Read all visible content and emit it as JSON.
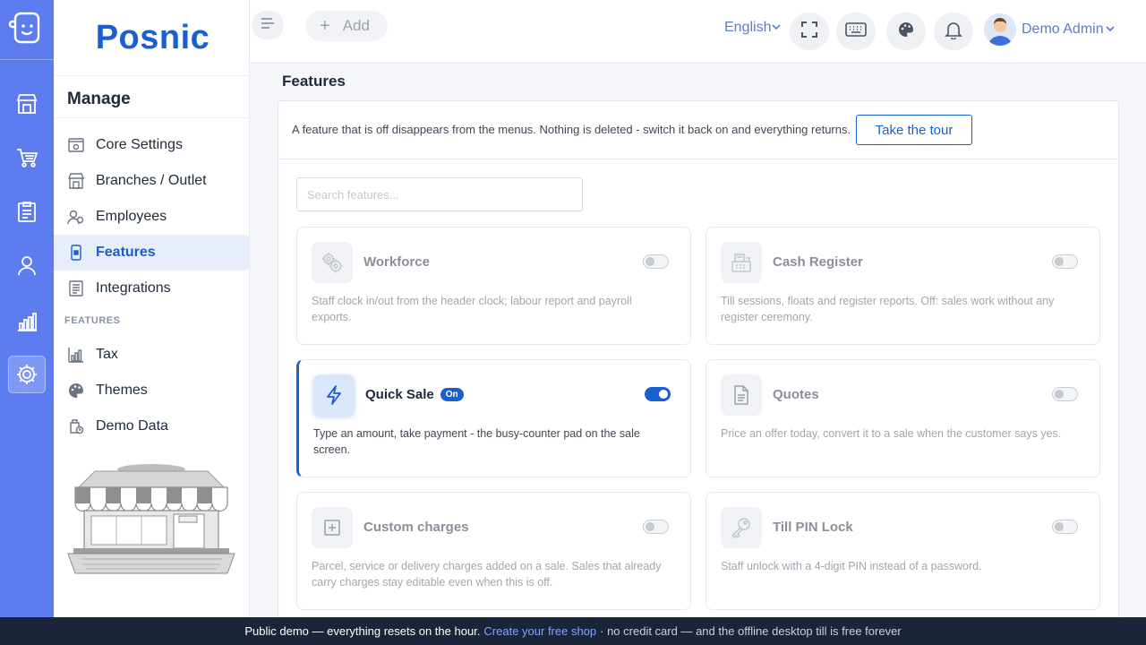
{
  "rail": {
    "items": [
      "logo-icon",
      "store-icon",
      "cart-icon",
      "clipboard-icon",
      "user-icon",
      "chart-icon",
      "settings-icon"
    ],
    "active": "settings-icon"
  },
  "brand": {
    "name": "Posnic"
  },
  "sidebar": {
    "section_title": "Manage",
    "items": [
      {
        "label": "Core Settings",
        "icon": "core-settings-icon"
      },
      {
        "label": "Branches / Outlet",
        "icon": "branches-icon"
      },
      {
        "label": "Employees",
        "icon": "employees-icon"
      },
      {
        "label": "Features",
        "icon": "features-icon",
        "active": true
      },
      {
        "label": "Integrations",
        "icon": "integrations-icon"
      }
    ],
    "group_label": "FEATURES",
    "feature_items": [
      {
        "label": "Tax",
        "icon": "tax-icon"
      },
      {
        "label": "Themes",
        "icon": "palette-icon"
      },
      {
        "label": "Demo Data",
        "icon": "demo-data-icon"
      }
    ]
  },
  "topbar": {
    "add_label": "Add",
    "language": "English",
    "user_name": "Demo Admin"
  },
  "main": {
    "title": "Features",
    "note": "A feature that is off disappears from the menus. Nothing is deleted - switch it back on and everything returns.",
    "tour_label": "Take the tour",
    "search_placeholder": "Search features...",
    "cards": [
      {
        "title": "Workforce",
        "desc": "Staff clock in/out from the header clock; labour report and payroll exports.",
        "on": false,
        "icon": "workforce-icon"
      },
      {
        "title": "Cash Register",
        "desc": "Till sessions, floats and register reports. Off: sales work without any register ceremony.",
        "on": false,
        "icon": "cash-register-icon"
      },
      {
        "title": "Quick Sale",
        "badge": "On",
        "desc": "Type an amount, take payment - the busy-counter pad on the sale screen.",
        "on": true,
        "icon": "lightning-icon"
      },
      {
        "title": "Quotes",
        "desc": "Price an offer today, convert it to a sale when the customer says yes.",
        "on": false,
        "icon": "document-icon"
      },
      {
        "title": "Custom charges",
        "desc": "Parcel, service or delivery charges added on a sale. Sales that already carry charges stay editable even when this is off.",
        "on": false,
        "icon": "plus-square-icon"
      },
      {
        "title": "Till PIN Lock",
        "desc": "Staff unlock with a 4-digit PIN instead of a password.",
        "on": false,
        "icon": "key-icon"
      }
    ]
  },
  "footer": {
    "text_before": "Public demo — everything resets on the hour.",
    "link": "Create your free shop",
    "text_after": "· no credit card — and the offline desktop till is free forever"
  },
  "colors": {
    "rail": "#5c7cf0",
    "accent": "#1a5fd1",
    "footer": "#1b2438"
  }
}
